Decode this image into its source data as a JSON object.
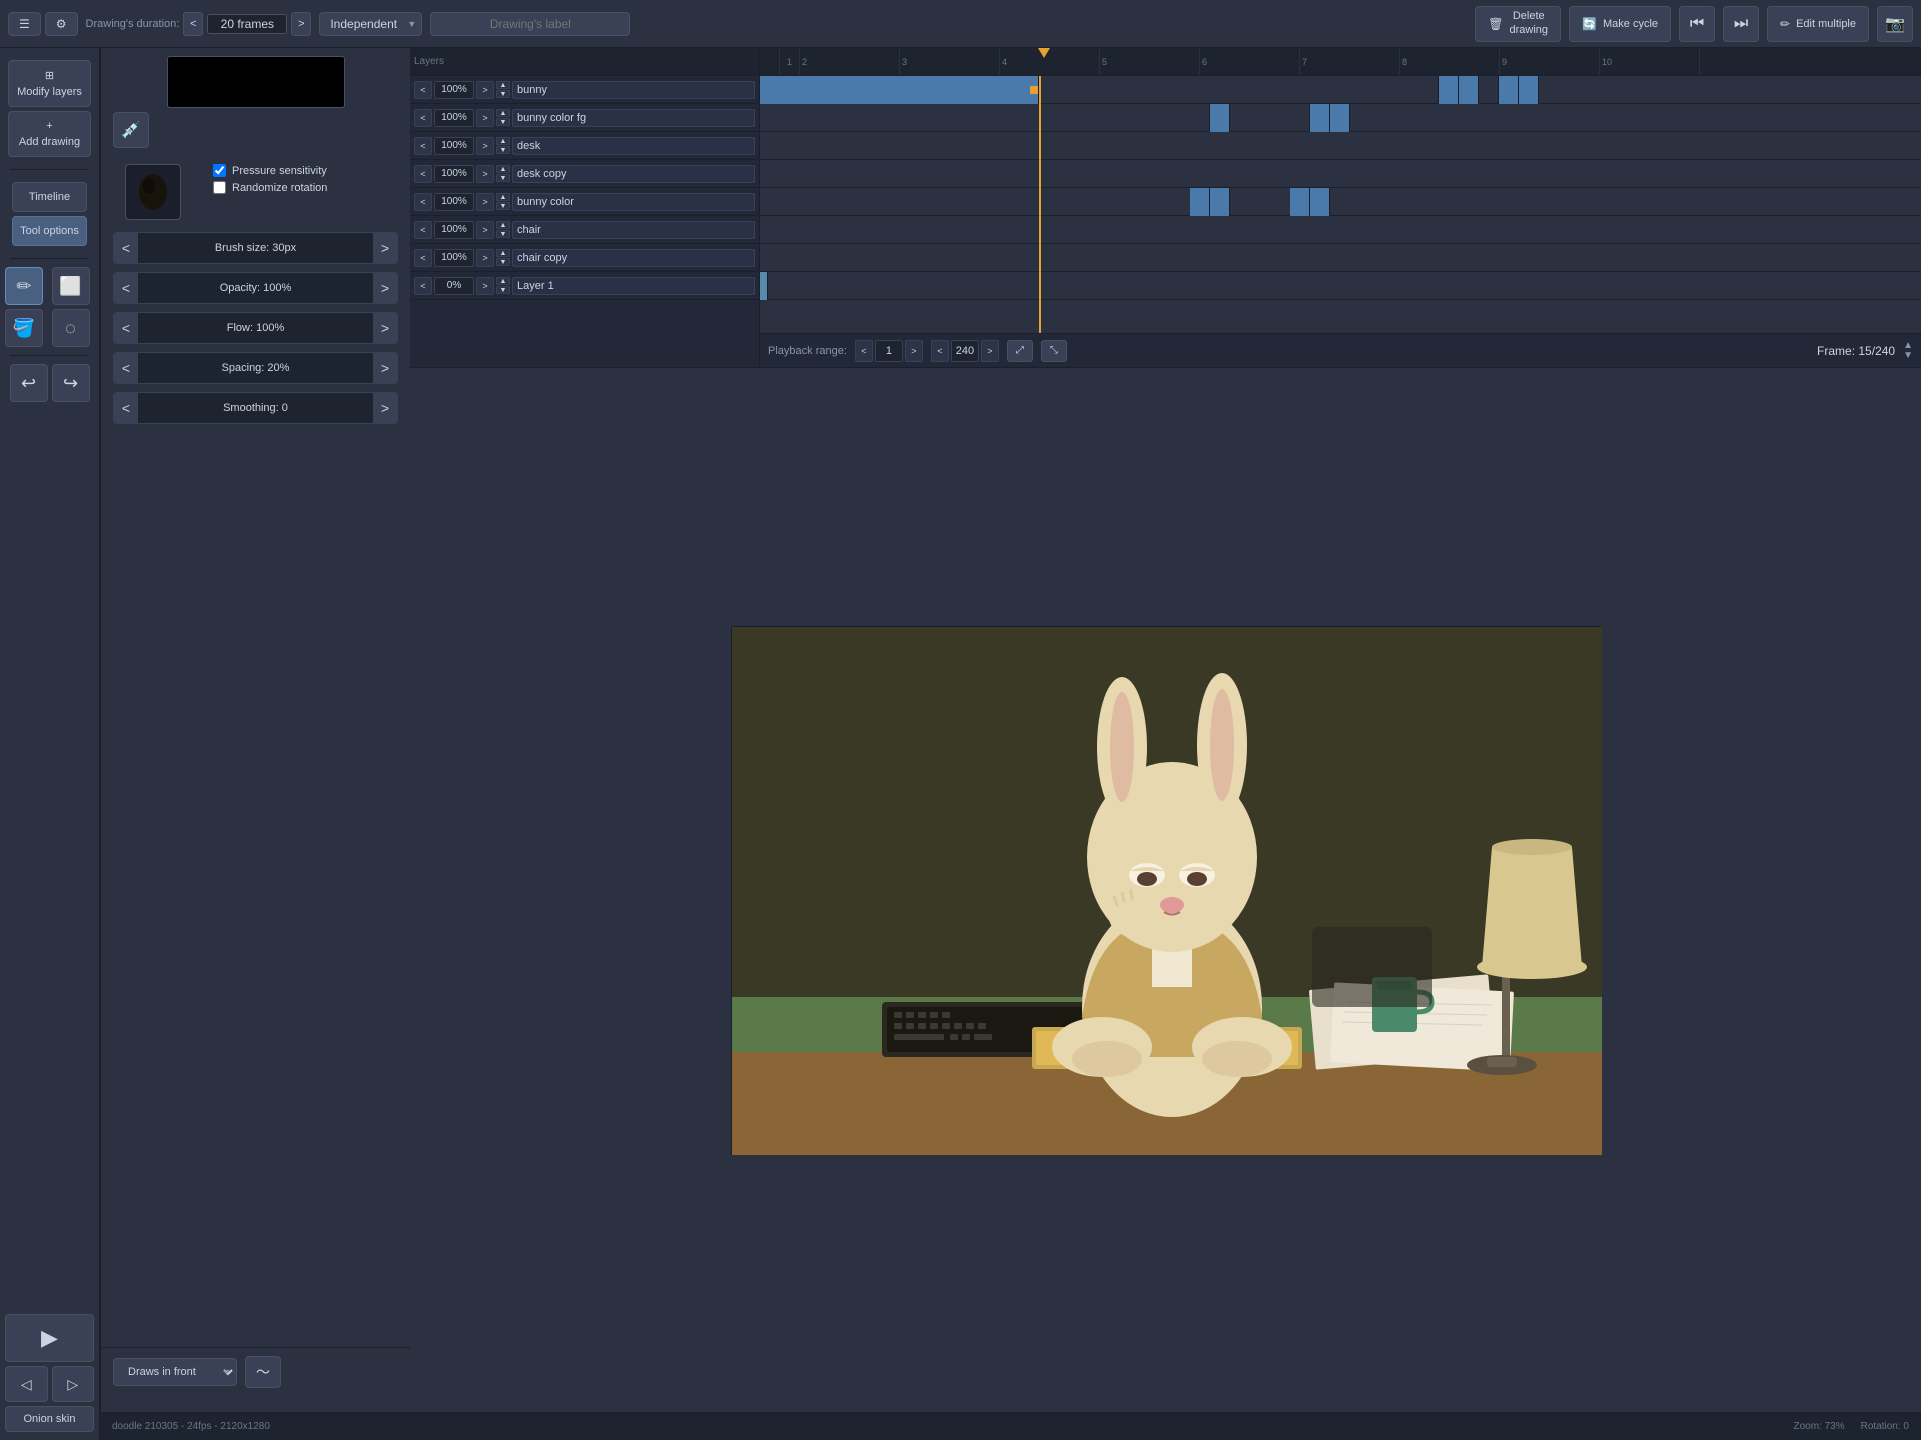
{
  "app": {
    "title": "doodle 210305 - 24fps - 2120x1280"
  },
  "toolbar": {
    "menu_label": "☰",
    "settings_label": "⚙",
    "drawing_duration_label": "Drawing's duration:",
    "duration_left": "<",
    "duration_value": "20 frames",
    "duration_right": ">",
    "independent_value": "Independent",
    "drawing_label_placeholder": "Drawing's label",
    "delete_drawing": "Delete\ndrawing",
    "make_cycle": "Make cycle",
    "edit_multiple": "Edit\nmultiple",
    "camera_icon": "📷"
  },
  "timeline": {
    "frame_info": "Frame: 15/240",
    "playback_range_label": "Playback range:",
    "pb_start": "1",
    "pb_end": "240",
    "layers": [
      {
        "name": "bunny",
        "percent": "100%"
      },
      {
        "name": "bunny color fg",
        "percent": "100%"
      },
      {
        "name": "desk",
        "percent": "100%"
      },
      {
        "name": "desk copy",
        "percent": "100%"
      },
      {
        "name": "bunny color",
        "percent": "100%"
      },
      {
        "name": "chair",
        "percent": "100%"
      },
      {
        "name": "chair copy",
        "percent": "100%"
      },
      {
        "name": "Layer 1",
        "percent": "0%"
      }
    ]
  },
  "tool_options": {
    "section_label": "Tool options",
    "brush_size_label": "Brush size: 30px",
    "opacity_label": "Opacity: 100%",
    "flow_label": "Flow: 100%",
    "spacing_label": "Spacing: 20%",
    "smoothing_label": "Smoothing: 0",
    "pressure_sensitivity_label": "Pressure sensitivity",
    "randomize_rotation_label": "Randomize rotation",
    "draws_in_front_label": "Draws in front",
    "wave_icon": "〜"
  },
  "sidebar": {
    "modify_layers_label": "Modify layers",
    "add_drawing_label": "Add drawing",
    "timeline_tab": "Timeline",
    "tool_options_tab": "Tool options",
    "undo_icon": "↩",
    "redo_icon": "↪",
    "play_icon": "▶",
    "onion_skin_label": "Onion skin",
    "scrub_left": "◀",
    "scrub_right": "▶"
  },
  "status_bar": {
    "file_info": "doodle 210305 - 24fps - 2120x1280",
    "zoom": "Zoom: 73%",
    "rotation": "Rotation: 0"
  },
  "colors": {
    "bg": "#2b3140",
    "panel_bg": "#232838",
    "accent": "#4d7a9a",
    "playhead": "#e8a030"
  }
}
